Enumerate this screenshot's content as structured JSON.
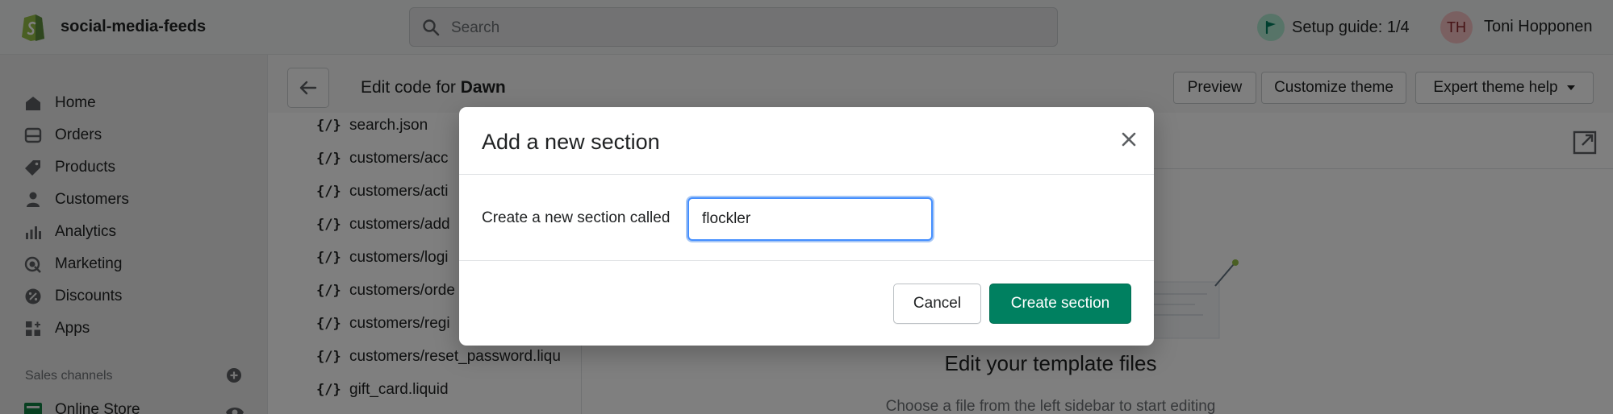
{
  "app": {
    "store_name": "social-media-feeds",
    "brand_color": "#008060"
  },
  "topbar": {
    "search_placeholder": "Search",
    "setup_guide": "Setup guide: 1/4",
    "user_initials": "TH",
    "user_name": "Toni Hopponen"
  },
  "sidebar": {
    "items": [
      {
        "label": "Home",
        "icon": "home-icon"
      },
      {
        "label": "Orders",
        "icon": "orders-icon"
      },
      {
        "label": "Products",
        "icon": "tag-icon"
      },
      {
        "label": "Customers",
        "icon": "person-icon"
      },
      {
        "label": "Analytics",
        "icon": "analytics-icon"
      },
      {
        "label": "Marketing",
        "icon": "marketing-icon"
      },
      {
        "label": "Discounts",
        "icon": "discount-icon"
      },
      {
        "label": "Apps",
        "icon": "apps-icon"
      }
    ],
    "sales_channels_label": "Sales channels",
    "online_store_label": "Online Store"
  },
  "header": {
    "edit_prefix": "Edit code for",
    "theme_name": "Dawn",
    "preview_label": "Preview",
    "customize_label": "Customize theme",
    "expert_label": "Expert theme help"
  },
  "files": [
    "search.json",
    "customers/acc",
    "customers/acti",
    "customers/add",
    "customers/logi",
    "customers/orde",
    "customers/regi",
    "customers/reset_password.liqu",
    "gift_card.liquid"
  ],
  "file_icon_text": "{/}",
  "editor": {
    "empty_title": "Edit your template files",
    "empty_subtitle": "Choose a file from the left sidebar to start editing"
  },
  "modal": {
    "title": "Add a new section",
    "field_label": "Create a new section called",
    "field_value": "flockler",
    "cancel_label": "Cancel",
    "create_label": "Create section"
  }
}
